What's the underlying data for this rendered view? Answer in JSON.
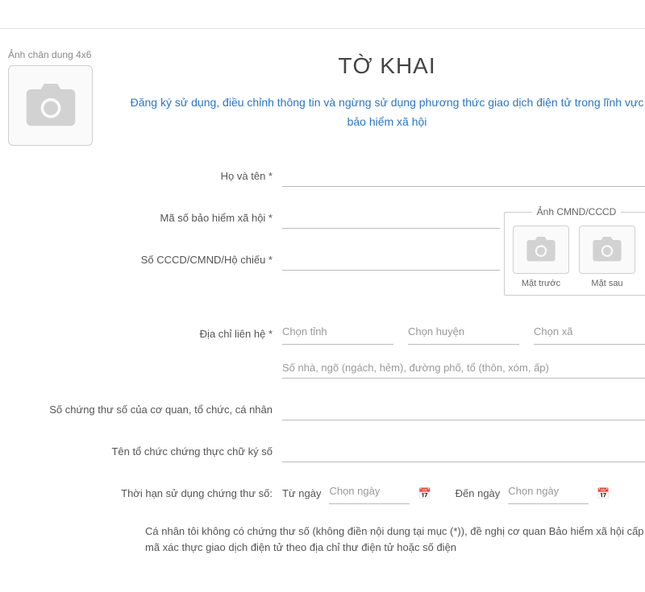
{
  "portrait": {
    "label": "Ảnh chân dung 4x6"
  },
  "title": {
    "main": "TỜ KHAI",
    "subtitle": "Đăng ký sử dụng, điều chỉnh thông tin và ngừng sử dụng phương thức giao dịch điện tử trong lĩnh vực bảo hiểm xã hội"
  },
  "labels": {
    "fullname": "Họ và tên *",
    "insurance_no": "Mã số bảo hiểm xã hội *",
    "id_no": "Số CCCD/CMND/Hộ chiếu *",
    "address": "Địa chỉ liên hệ *",
    "cert_no": "Số chứng thư số của cơ quan, tổ chức, cá nhân",
    "cert_org": "Tên tổ chức chứng thực chữ ký số",
    "cert_validity": "Thời hạn sử dụng chứng thư số:"
  },
  "id_photo": {
    "legend": "Ảnh CMND/CCCD",
    "front": "Mặt trước",
    "back": "Mặt sau"
  },
  "address": {
    "province_placeholder": "Chọn tỉnh",
    "district_placeholder": "Chọn huyện",
    "ward_placeholder": "Chọn xã",
    "detail_placeholder": "Số nhà, ngõ (ngách, hẻm), đường phố, tổ (thôn, xóm, ấp)"
  },
  "dates": {
    "from_label": "Từ ngày",
    "to_label": "Đến ngày",
    "placeholder": "Chọn ngày"
  },
  "footer": "Cá nhân tôi không có chứng thư số (không điền nội dung tại mục (*)), đề nghị cơ quan Bảo hiểm xã hội cấp mã xác thực giao dịch điện tử theo địa chỉ thư điện tử hoặc số điện"
}
